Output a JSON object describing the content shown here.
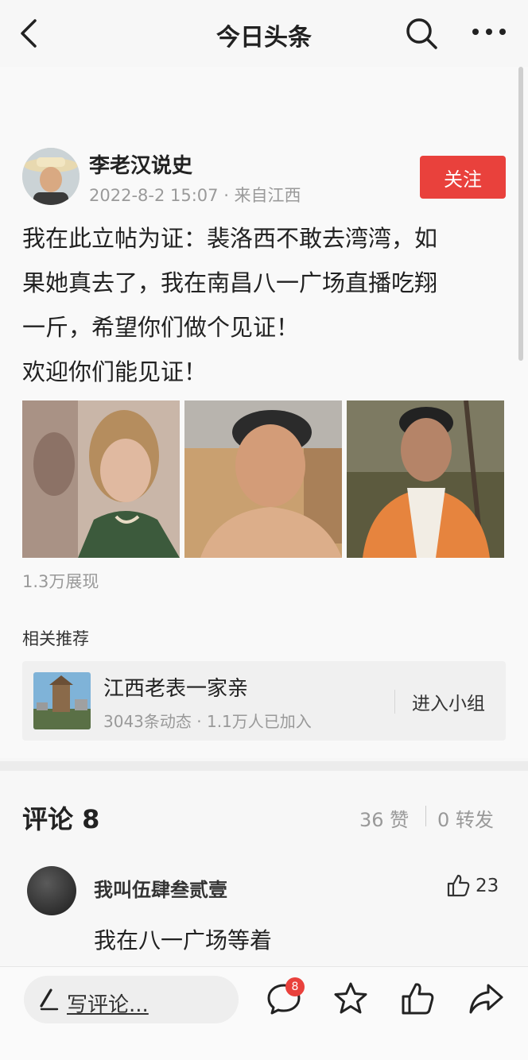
{
  "header": {
    "title": "今日头条",
    "icons": [
      "back-icon",
      "search-icon",
      "more-icon"
    ]
  },
  "post": {
    "author": "李老汉说史",
    "meta": "2022-8-2 15:07 · 来自江西",
    "follow_label": "关注",
    "lines": [
      "我在此立帖为证：裴洛西不敢去湾湾，如",
      "果她真去了，我在南昌八一广场直播吃翔",
      "一斤，希望你们做个见证！",
      "欢迎你们能见证！"
    ],
    "views": "1.3万展现"
  },
  "related": {
    "title": "相关推荐",
    "group_name": "江西老表一家亲",
    "group_stats": "3043条动态 · 1.1万人已加入",
    "join_label": "进入小组"
  },
  "comments": {
    "title": "评论 8",
    "likes": "36 赞",
    "shares": "0 转发",
    "items": [
      {
        "user": "我叫伍肆叁贰壹",
        "likes": "23",
        "text": "我在八一广场等着"
      }
    ]
  },
  "bottombar": {
    "write_label": "写评论...",
    "comment_badge": "8",
    "icons": [
      "comment-icon",
      "star-icon",
      "like-icon",
      "share-icon"
    ]
  },
  "colors": {
    "accent_red": "#e9413c",
    "muted_gray": "#999999"
  }
}
